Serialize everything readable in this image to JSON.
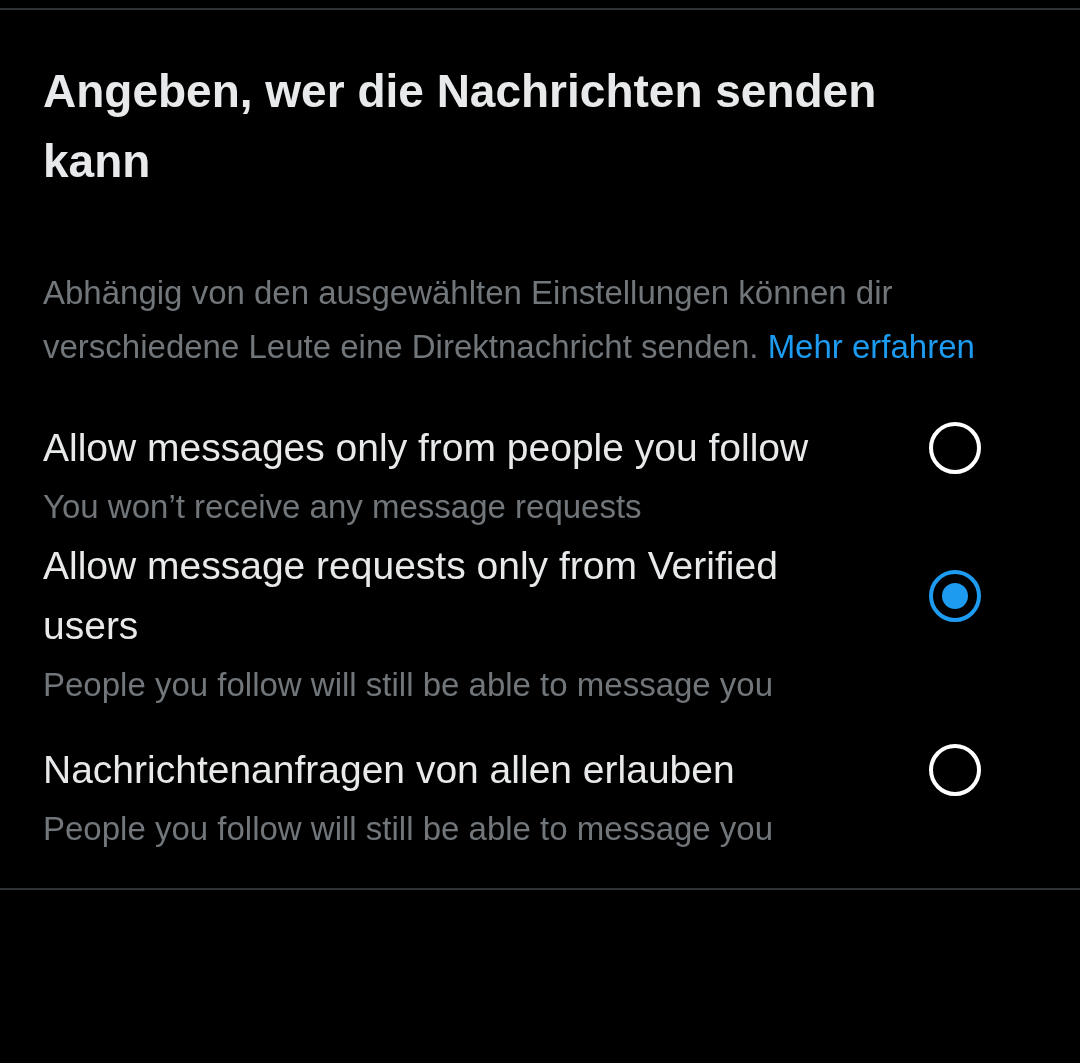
{
  "title": "Angeben, wer die Nachrichten senden kann",
  "description": {
    "text": "Abhängig von den ausgewählten Einstellungen können dir verschiedene Leute eine Direktnachricht senden.",
    "link": "Mehr erfahren"
  },
  "options": [
    {
      "label": "Allow messages only from people you follow",
      "hint": "You won’t receive any message requests",
      "selected": false
    },
    {
      "label": "Allow message requests only from Verified users",
      "hint": "People you follow will still be able to message you",
      "selected": true
    },
    {
      "label": "Nachrichtenanfragen von allen erlauben",
      "hint": "People you follow will still be able to message you",
      "selected": false
    }
  ]
}
